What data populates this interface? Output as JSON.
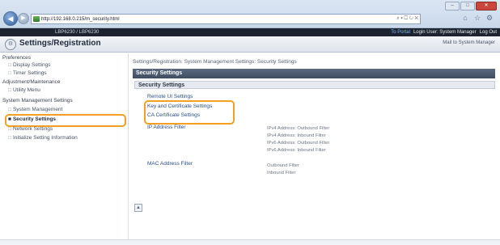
{
  "browser": {
    "url": "http://192.168.0.215/m_security.html",
    "address_controls": "⌕ ▾ ☐ ↻ ✕",
    "icons": [
      "home-icon",
      "star-icon",
      "gear-icon"
    ]
  },
  "device": {
    "name": "LBP6230 / LBP6230",
    "to_portal": "To Portal",
    "login_user": "Login User: System Manager",
    "logout": "Log Out"
  },
  "title_bar": {
    "title": "Settings/Registration",
    "mail_link": "Mail to System Manager"
  },
  "sidebar": {
    "preferences_heading": "Preferences",
    "display_settings": "Display Settings",
    "timer_settings": "Timer Settings",
    "adjustment_heading": "Adjustment/Maintenance",
    "utility_menu": "Utility Menu",
    "system_mgmt_heading": "System Management Settings",
    "system_management": "System Management",
    "security_settings": "Security Settings",
    "network_settings": "Network Settings",
    "initialize_setting_information": "Initialize Setting Information"
  },
  "main": {
    "breadcrumb": "Settings/Registration: System Management Settings: Security Settings",
    "section_title": "Security Settings",
    "subsection_title": "Security Settings",
    "links": {
      "remote_ui_settings": "Remote UI Settings",
      "key_cert_settings": "Key and Certificate Settings",
      "ca_cert_settings": "CA Certificate Settings",
      "ip_address_filter": "IP Address Filter",
      "mac_address_filter": "MAC Address Filter"
    },
    "ip_filter_desc": [
      "IPv4 Address: Outbound Filter",
      "IPv4 Address: Inbound Filter",
      "IPv6 Address: Outbound Filter",
      "IPv6 Address: Inbound Filter"
    ],
    "mac_filter_desc": [
      "Outbound Filter",
      "Inbound Filter"
    ],
    "top_button": "▲"
  },
  "colors": {
    "highlight": "#f5a020",
    "section_bar": "#4a576b",
    "link": "#2d4f86"
  }
}
